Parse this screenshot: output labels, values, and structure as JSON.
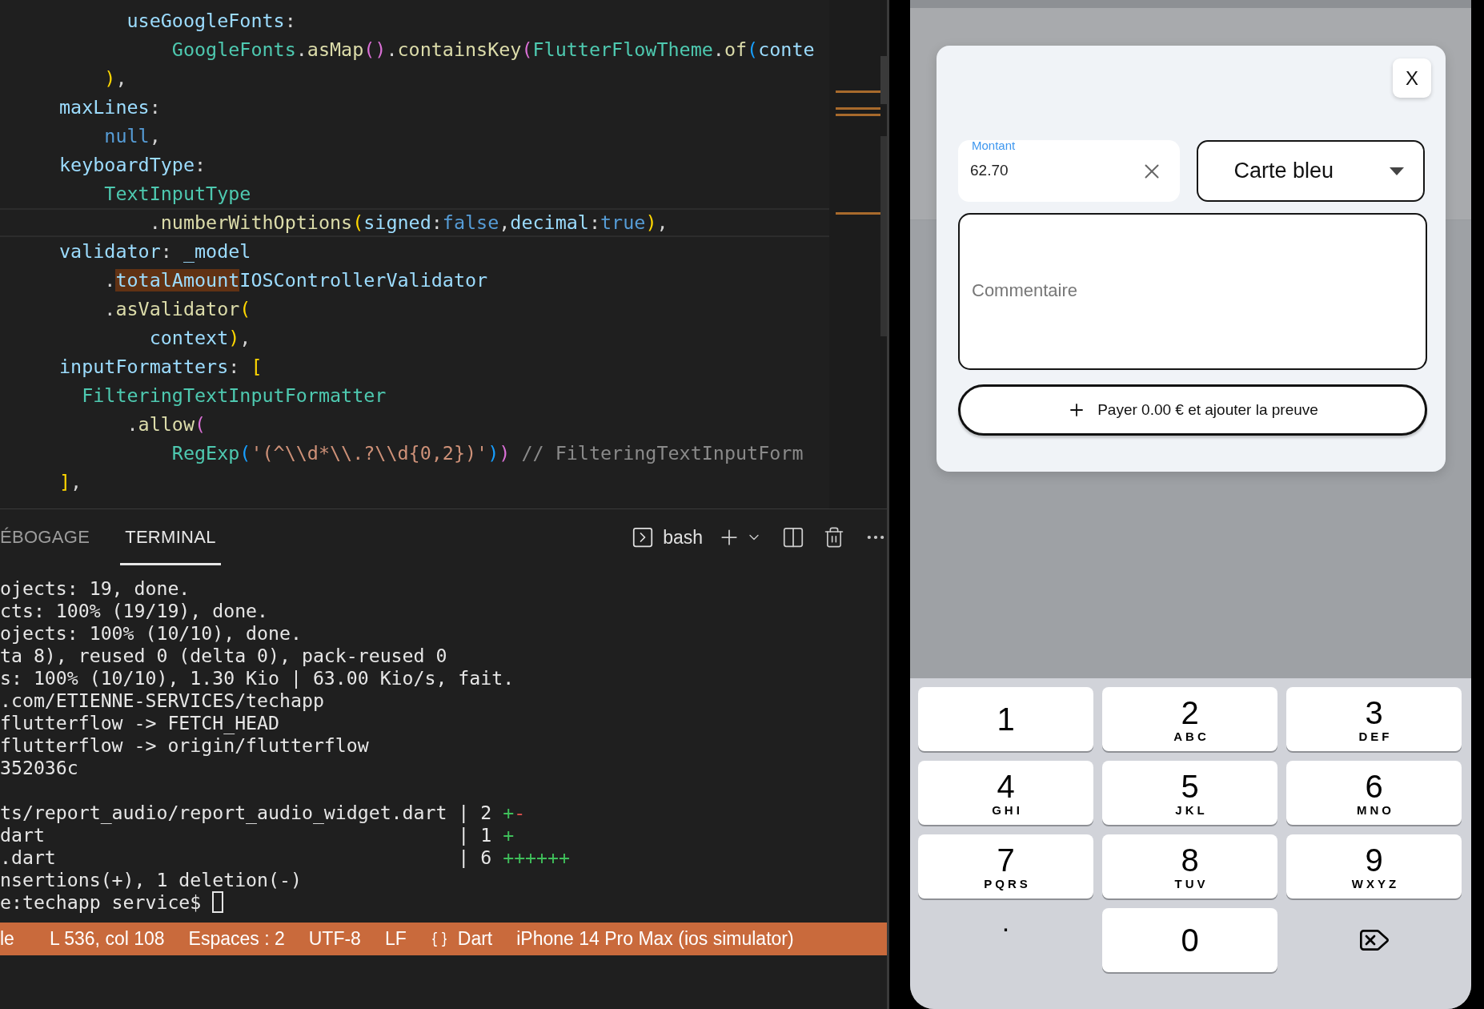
{
  "editor": {
    "lines": [
      {
        "current": false,
        "tokens": [
          {
            "kind": "prop",
            "text": "      useGoogleFonts"
          },
          {
            "kind": "punct",
            "text": ":"
          }
        ]
      },
      {
        "current": false,
        "tokens": [
          {
            "kind": "class",
            "text": "          GoogleFonts"
          },
          {
            "kind": "punct",
            "text": "."
          },
          {
            "kind": "method",
            "text": "asMap"
          },
          {
            "kind": "bracket2",
            "text": "()"
          },
          {
            "kind": "punct",
            "text": "."
          },
          {
            "kind": "method",
            "text": "containsKey"
          },
          {
            "kind": "bracket2",
            "text": "("
          },
          {
            "kind": "class",
            "text": "FlutterFlowTheme"
          },
          {
            "kind": "punct",
            "text": "."
          },
          {
            "kind": "method",
            "text": "of"
          },
          {
            "kind": "bracket3",
            "text": "("
          },
          {
            "kind": "prop",
            "text": "conte"
          }
        ]
      },
      {
        "current": false,
        "tokens": [
          {
            "kind": "bracket1",
            "text": "    )"
          },
          {
            "kind": "punct",
            "text": ","
          }
        ]
      },
      {
        "current": false,
        "tokens": [
          {
            "kind": "prop",
            "text": "maxLines"
          },
          {
            "kind": "punct",
            "text": ":"
          }
        ]
      },
      {
        "current": false,
        "tokens": [
          {
            "kind": "keyword",
            "text": "    null"
          },
          {
            "kind": "punct",
            "text": ","
          }
        ]
      },
      {
        "current": false,
        "tokens": [
          {
            "kind": "prop",
            "text": "keyboardType"
          },
          {
            "kind": "punct",
            "text": ":"
          }
        ]
      },
      {
        "current": false,
        "tokens": [
          {
            "kind": "class",
            "text": "    TextInputType"
          }
        ]
      },
      {
        "current": true,
        "tokens": [
          {
            "kind": "punct",
            "text": "        ."
          },
          {
            "kind": "method",
            "text": "numberWithOptions"
          },
          {
            "kind": "bracket1",
            "text": "("
          },
          {
            "kind": "prop",
            "text": "signed"
          },
          {
            "kind": "punct",
            "text": ":"
          },
          {
            "kind": "keyword",
            "text": "false"
          },
          {
            "kind": "punct",
            "text": ","
          },
          {
            "kind": "prop",
            "text": "decimal"
          },
          {
            "kind": "punct",
            "text": ":"
          },
          {
            "kind": "keyword",
            "text": "true"
          },
          {
            "kind": "bracket1",
            "text": ")"
          },
          {
            "kind": "punct",
            "text": ","
          }
        ]
      },
      {
        "current": false,
        "tokens": [
          {
            "kind": "prop",
            "text": "validator"
          },
          {
            "kind": "punct",
            "text": ": "
          },
          {
            "kind": "prop",
            "text": "_model"
          }
        ]
      },
      {
        "current": false,
        "tokens": [
          {
            "kind": "punct",
            "text": "    ."
          },
          {
            "kind": "match",
            "text": "totalAmount"
          },
          {
            "kind": "prop",
            "text": "IOSControllerValidator"
          }
        ]
      },
      {
        "current": false,
        "tokens": [
          {
            "kind": "punct",
            "text": "    ."
          },
          {
            "kind": "method",
            "text": "asValidator"
          },
          {
            "kind": "bracket1",
            "text": "("
          }
        ]
      },
      {
        "current": false,
        "tokens": [
          {
            "kind": "prop",
            "text": "        context"
          },
          {
            "kind": "bracket1",
            "text": ")"
          },
          {
            "kind": "punct",
            "text": ","
          }
        ]
      },
      {
        "current": false,
        "tokens": [
          {
            "kind": "prop",
            "text": "inputFormatters"
          },
          {
            "kind": "punct",
            "text": ": "
          },
          {
            "kind": "bracket1",
            "text": "["
          }
        ]
      },
      {
        "current": false,
        "tokens": [
          {
            "kind": "class",
            "text": "  FilteringTextInputFormatter"
          }
        ]
      },
      {
        "current": false,
        "tokens": [
          {
            "kind": "punct",
            "text": "      ."
          },
          {
            "kind": "method",
            "text": "allow"
          },
          {
            "kind": "bracket2",
            "text": "("
          }
        ]
      },
      {
        "current": false,
        "tokens": [
          {
            "kind": "class",
            "text": "          RegExp"
          },
          {
            "kind": "bracket3",
            "text": "("
          },
          {
            "kind": "string",
            "text": "'(^\\\\d*\\\\.?\\\\d{0,2})'"
          },
          {
            "kind": "bracket3",
            "text": ")"
          },
          {
            "kind": "bracket2",
            "text": ")"
          },
          {
            "kind": "comment",
            "text": " // FilteringTextInputForm"
          }
        ]
      },
      {
        "current": false,
        "tokens": [
          {
            "kind": "bracket1",
            "text": "]"
          },
          {
            "kind": "punct",
            "text": ","
          }
        ]
      }
    ]
  },
  "panel": {
    "tabs": [
      {
        "label": "ÉBOGAGE",
        "selected": false
      },
      {
        "label": "TERMINAL",
        "selected": true
      }
    ],
    "shell": "bash"
  },
  "terminal": {
    "lines": [
      {
        "kind": "output",
        "tokens": [
          {
            "kind": "plain",
            "text": "ojects: 19, done."
          }
        ]
      },
      {
        "kind": "output",
        "tokens": [
          {
            "kind": "plain",
            "text": "cts: 100% (19/19), done."
          }
        ]
      },
      {
        "kind": "output",
        "tokens": [
          {
            "kind": "plain",
            "text": "ojects: 100% (10/10), done."
          }
        ]
      },
      {
        "kind": "output",
        "tokens": [
          {
            "kind": "plain",
            "text": "ta 8), reused 0 (delta 0), pack-reused 0"
          }
        ]
      },
      {
        "kind": "output",
        "tokens": [
          {
            "kind": "plain",
            "text": "s: 100% (10/10), 1.30 Kio | 63.00 Kio/s, fait."
          }
        ]
      },
      {
        "kind": "output",
        "tokens": [
          {
            "kind": "plain",
            "text": ".com/ETIENNE-SERVICES/techapp"
          }
        ]
      },
      {
        "kind": "output",
        "tokens": [
          {
            "kind": "plain",
            "text": "flutterflow -> FETCH_HEAD"
          }
        ]
      },
      {
        "kind": "output",
        "tokens": [
          {
            "kind": "plain",
            "text": "flutterflow -> origin/flutterflow"
          }
        ]
      },
      {
        "kind": "output",
        "tokens": [
          {
            "kind": "plain",
            "text": "352036c"
          }
        ]
      },
      {
        "kind": "blank"
      },
      {
        "kind": "output",
        "tokens": [
          {
            "kind": "plain",
            "text": "ts/report_audio/report_audio_widget.dart | 2 "
          },
          {
            "kind": "added",
            "text": "+"
          },
          {
            "kind": "removed",
            "text": "-"
          }
        ]
      },
      {
        "kind": "output",
        "tokens": [
          {
            "kind": "plain",
            "text": "dart                                     | 1 "
          },
          {
            "kind": "added",
            "text": "+"
          }
        ]
      },
      {
        "kind": "output",
        "tokens": [
          {
            "kind": "plain",
            "text": ".dart                                    | 6 "
          },
          {
            "kind": "added",
            "text": "++++++"
          }
        ]
      },
      {
        "kind": "output",
        "tokens": [
          {
            "kind": "plain",
            "text": "nsertions(+), 1 deletion(-)"
          }
        ]
      },
      {
        "kind": "output",
        "tokens": [
          {
            "kind": "plain",
            "text": "e:techapp service$ "
          },
          {
            "kind": "cursor"
          }
        ]
      }
    ]
  },
  "status_bar": {
    "items": [
      {
        "kind": "plain",
        "text": "le"
      },
      {
        "kind": "plain",
        "text": "L 536, col 108"
      },
      {
        "kind": "plain",
        "text": "Espaces : 2"
      },
      {
        "kind": "plain",
        "text": "UTF-8"
      },
      {
        "kind": "plain",
        "text": "LF"
      },
      {
        "kind": "language",
        "text": "Dart"
      },
      {
        "kind": "plain",
        "text": "iPhone 14 Pro Max (ios simulator)"
      }
    ]
  },
  "phone": {
    "dialog": {
      "close": "X",
      "amount": {
        "label": "Montant",
        "value": "62.70"
      },
      "method": {
        "value": "Carte bleu"
      },
      "comment": {
        "placeholder": "Commentaire"
      },
      "pay_button": "Payer 0.00 € et ajouter la preuve"
    },
    "keypad": {
      "keys": [
        {
          "kind": "key",
          "digit": "1"
        },
        {
          "kind": "key",
          "digit": "2",
          "letters": "ABC"
        },
        {
          "kind": "key",
          "digit": "3",
          "letters": "DEF"
        },
        {
          "kind": "key",
          "digit": "4",
          "letters": "GHI"
        },
        {
          "kind": "key",
          "digit": "5",
          "letters": "JKL"
        },
        {
          "kind": "key",
          "digit": "6",
          "letters": "MNO"
        },
        {
          "kind": "key",
          "digit": "7",
          "letters": "PQRS"
        },
        {
          "kind": "key",
          "digit": "8",
          "letters": "TUV"
        },
        {
          "kind": "key",
          "digit": "9",
          "letters": "WXYZ"
        },
        {
          "kind": "plain",
          "digit": "."
        },
        {
          "kind": "key",
          "digit": "0"
        },
        {
          "kind": "backspace"
        }
      ]
    }
  }
}
